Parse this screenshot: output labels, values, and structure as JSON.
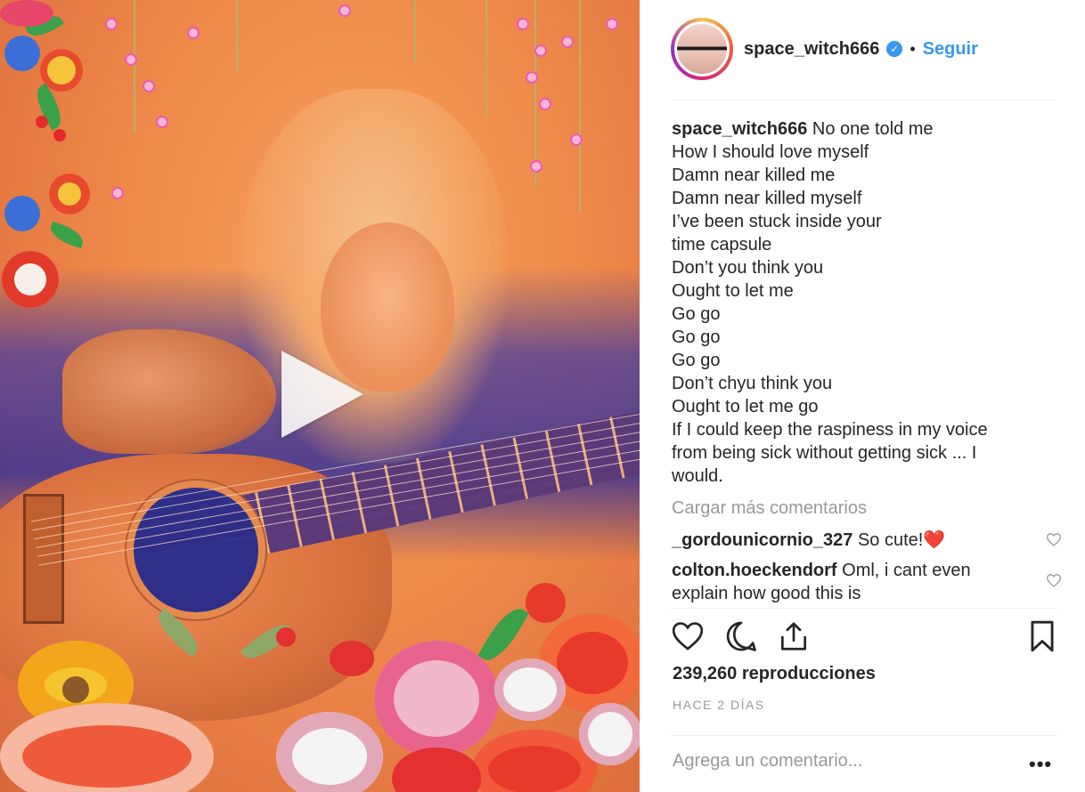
{
  "post": {
    "username": "space_witch666",
    "follow_label": "Seguir",
    "dot": "•",
    "verified_icon": "verified-badge-icon"
  },
  "caption": {
    "user": "space_witch666",
    "lines": [
      "No one told me",
      "How I should love myself",
      "Damn near killed me",
      "Damn near killed myself",
      "I’ve been stuck inside your",
      "time capsule",
      "Don’t you think you",
      "Ought to let me",
      "Go go",
      "Go go",
      "Go go",
      "Don’t chyu think you",
      "Ought to let me go",
      "If I could keep the raspiness in my voice",
      "from being sick without getting sick ... I",
      "would."
    ]
  },
  "load_more_label": "Cargar más comentarios",
  "comments": [
    {
      "user": "_gordounicornio_327",
      "text": "So cute!❤️"
    },
    {
      "user": "colton.hoeckendorf",
      "text": "Oml, i cant even explain how good this is"
    }
  ],
  "stats": {
    "views": "239,260 reproducciones",
    "date": "HACE 2 DÍAS"
  },
  "comment_input": {
    "placeholder": "Agrega un comentario..."
  },
  "more_label": "•••",
  "colors": {
    "accent": "#3897f0",
    "text": "#262626",
    "muted": "#999999"
  }
}
